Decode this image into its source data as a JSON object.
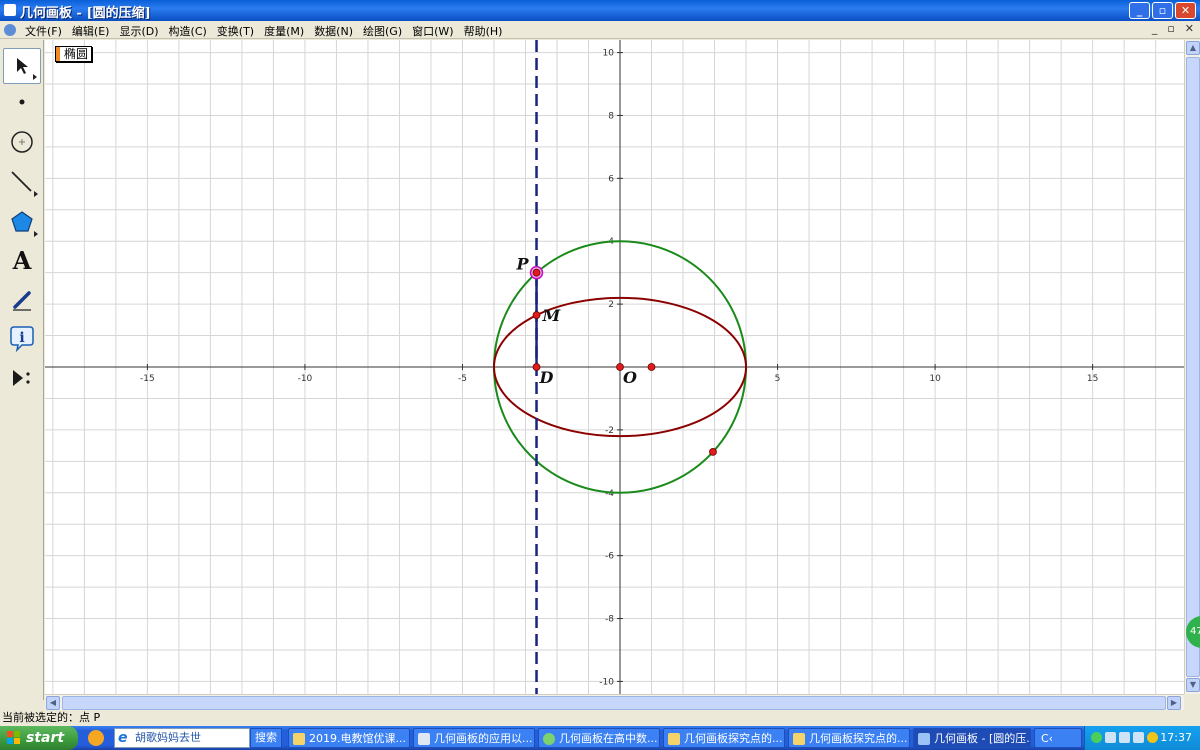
{
  "window": {
    "title": "几何画板 - [圆的压缩]",
    "buttons": [
      "_",
      "▫",
      "✕"
    ],
    "mdi_buttons": [
      "_",
      "▫",
      "✕"
    ]
  },
  "menu": [
    "文件(F)",
    "编辑(E)",
    "显示(D)",
    "构造(C)",
    "变换(T)",
    "度量(M)",
    "数据(N)",
    "绘图(G)",
    "窗口(W)",
    "帮助(H)"
  ],
  "toolbox": [
    {
      "name": "arrow-select",
      "icon": "arrow-icon"
    },
    {
      "name": "point",
      "icon": "point-icon"
    },
    {
      "name": "compass",
      "icon": "compass-icon"
    },
    {
      "name": "straightedge",
      "icon": "line-icon"
    },
    {
      "name": "polygon",
      "icon": "polygon-icon"
    },
    {
      "name": "text",
      "icon": "text-a-icon",
      "label": "A"
    },
    {
      "name": "marker",
      "icon": "pen-icon"
    },
    {
      "name": "information",
      "icon": "info-icon",
      "label": "i"
    },
    {
      "name": "custom",
      "icon": "play-more-icon"
    }
  ],
  "canvas": {
    "ellipse_button": "椭圆",
    "axis": {
      "x_ticks": [
        -15,
        -10,
        -5,
        5,
        10,
        15
      ],
      "y_ticks": [
        10,
        8,
        6,
        4,
        2,
        -2,
        -4,
        -6,
        -8,
        -10
      ],
      "x_range": [
        -18.25,
        17.9
      ],
      "y_range": [
        -10.4,
        10.4
      ]
    },
    "circle": {
      "center": [
        0,
        0
      ],
      "radius": 4,
      "color": "#1a8a1a"
    },
    "ellipse": {
      "center": [
        0,
        0
      ],
      "a": 4,
      "b": 2.2,
      "color": "#8b0000"
    },
    "dashed_line": {
      "x": -2.65,
      "color": "#1a237e"
    },
    "points": [
      {
        "label": "P",
        "x": -2.65,
        "y": 3.0
      },
      {
        "label": "M",
        "x": -2.65,
        "y": 1.65
      },
      {
        "label": "D",
        "x": -2.65,
        "y": 0
      },
      {
        "label": "O",
        "x": 0,
        "y": 0
      },
      {
        "label": "",
        "x": 1.0,
        "y": 0
      },
      {
        "label": "",
        "x": 2.95,
        "y": -2.7
      }
    ]
  },
  "status": "当前被选定的：点 P",
  "taskbar": {
    "start": "start",
    "search_text": "胡歌妈妈去世",
    "search_button": "搜索",
    "items": [
      "2019.电教馆优课...",
      "几何画板的应用以...",
      "几何画板在高中数...",
      "几何画板探究点的...",
      "几何画板探究点的...",
      "几何画板 - [圆的压...",
      "C‹"
    ],
    "clock": "17:37"
  },
  "side_badge": "47"
}
